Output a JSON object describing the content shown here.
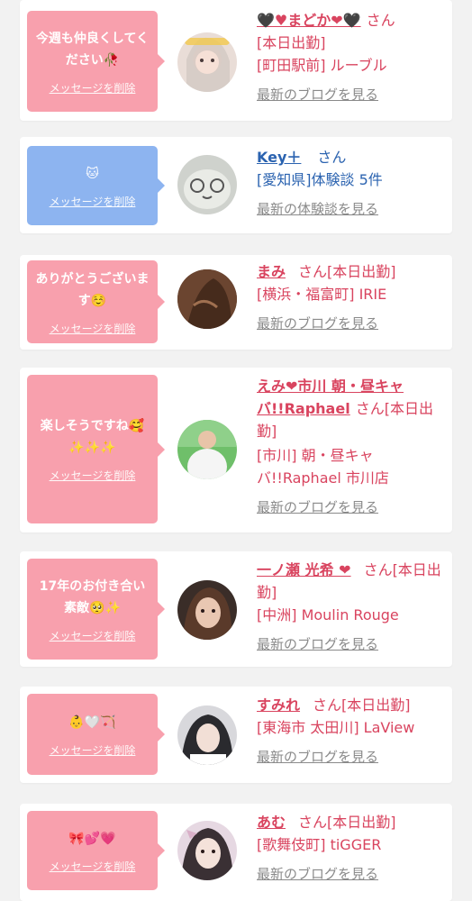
{
  "delete_label": "メッセージを削除",
  "colors": {
    "bubble_pink": "#f8a0ad",
    "bubble_blue": "#8db4f0",
    "name_pink": "#d9445f",
    "name_blue": "#2b63b0",
    "link_gray": "#8a8a8a"
  },
  "cards": [
    {
      "message": "今週も仲良くしてください🥀",
      "name": "🖤♥まどか❤🖤",
      "honorific": "さん",
      "lines": [
        "[本日出勤]",
        "[町田駅前] ルーブル"
      ],
      "link": "最新のブログを見る"
    },
    {
      "message": "🐱",
      "name": "Key＋",
      "honorific": "さん",
      "lines": [
        "[愛知県]体験談 5件"
      ],
      "link": "最新の体験談を見る"
    },
    {
      "message": "ありがとうございます☺️",
      "name": "まみ",
      "honorific": "さん[本日出勤]",
      "lines": [
        "[横浜・福富町] IRIE"
      ],
      "link": "最新のブログを見る"
    },
    {
      "message": "楽しそうですね🥰✨✨✨",
      "name": "えみ❤市川 朝・昼キャバ!!Raphael",
      "honorific": "さん[本日出勤]",
      "lines": [
        "[市川] 朝・昼キャバ!!Raphael 市川店"
      ],
      "link": "最新のブログを見る"
    },
    {
      "message": "17年のお付き合い素敵🥺✨",
      "name": "一ノ瀬 光希 ❤",
      "honorific": "さん[本日出勤]",
      "lines": [
        "[中洲] Moulin Rouge"
      ],
      "link": "最新のブログを見る"
    },
    {
      "message": "👶🤍🏹",
      "name": "すみれ",
      "honorific": "さん[本日出勤]",
      "lines": [
        "[東海市 太田川] LaView"
      ],
      "link": "最新のブログを見る"
    },
    {
      "message": "🎀💕💗",
      "name": "あむ",
      "honorific": "さん[本日出勤]",
      "lines": [
        "[歌舞伎町] tiGGER"
      ],
      "link": "最新のブログを見る"
    }
  ]
}
